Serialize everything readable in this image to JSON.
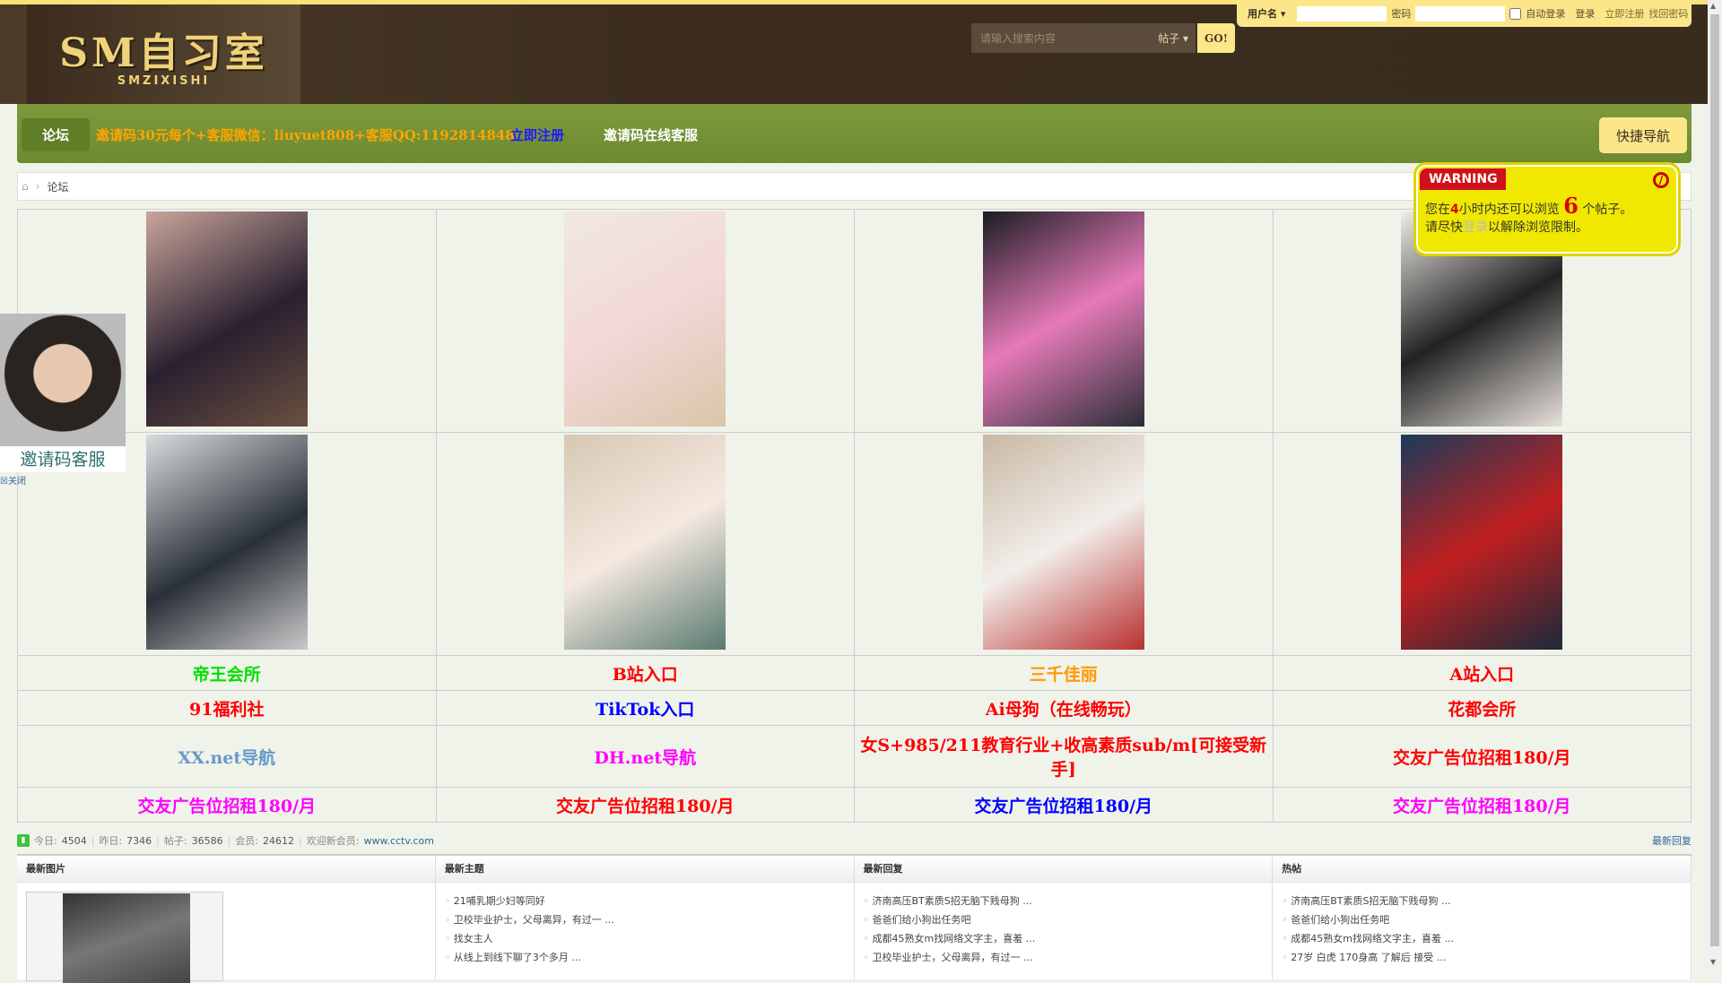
{
  "header": {
    "logo_text": "SM自习室",
    "logo_sub": "SMZIXISHI",
    "search_placeholder": "请输入搜索内容",
    "search_scope": "帖子",
    "go_label": "GO!"
  },
  "login": {
    "username_label": "用户名",
    "password_label": "密码",
    "auto_login": "自动登录",
    "login": "登录",
    "register": "立即注册",
    "forgot": "找回密码"
  },
  "nav": {
    "home": "论坛",
    "promo": "邀请码30元每个+客服微信：liuyuet808+客服QQ:1192814848",
    "register": "立即注册",
    "service": "邀请码在线客服",
    "quick": "快捷导航"
  },
  "breadcrumb": {
    "current": "论坛"
  },
  "links": [
    [
      {
        "t": "帝王会所",
        "c": "#00e000"
      },
      {
        "t": "B站入口",
        "c": "#ff0000"
      },
      {
        "t": "三千佳丽",
        "c": "#ff9900"
      },
      {
        "t": "A站入口",
        "c": "#ff0000"
      }
    ],
    [
      {
        "t": "91福利社",
        "c": "#ff0000"
      },
      {
        "t": "TikTok入口",
        "c": "#0000ff"
      },
      {
        "t": "Ai母狗（在线畅玩）",
        "c": "#ff0000"
      },
      {
        "t": "花都会所",
        "c": "#ff0000"
      }
    ],
    [
      {
        "t": "XX.net导航",
        "c": "#6699cc"
      },
      {
        "t": "DH.net导航",
        "c": "#ff00ff"
      },
      {
        "t": "女S+985/211教育行业+收高素质sub/m[可接受新手]",
        "c": "#ff0000"
      },
      {
        "t": "交友广告位招租180/月",
        "c": "#ff0000"
      }
    ],
    [
      {
        "t": "交友广告位招租180/月",
        "c": "#ff00ff"
      },
      {
        "t": "交友广告位招租180/月",
        "c": "#ff0000"
      },
      {
        "t": "交友广告位招租180/月",
        "c": "#0000ff"
      },
      {
        "t": "交友广告位招租180/月",
        "c": "#ff00ff"
      }
    ]
  ],
  "stats": {
    "today_label": "今日:",
    "today": "4504",
    "yesterday_label": "昨日:",
    "yesterday": "7346",
    "posts_label": "帖子:",
    "posts": "36586",
    "members_label": "会员:",
    "members": "24612",
    "welcome_label": "欢迎新会员:",
    "newest": "www.cctv.com",
    "latest_reply_link": "最新回复"
  },
  "panels": {
    "pics": "最新图片",
    "topics": "最新主题",
    "replies": "最新回复",
    "hot": "热帖",
    "topic_items": [
      "21哺乳期少妇等同好",
      "卫校毕业护士，父母离异，有过一 ...",
      "找女主人",
      "从线上到线下聊了3个多月 ..."
    ],
    "reply_items": [
      "济南高压BT素质S招无脑下贱母狗 ...",
      "爸爸们给小狗出任务吧",
      "成都45熟女m找网络文字主，喜羞 ...",
      "卫校毕业护士，父母离异，有过一 ..."
    ],
    "hot_items": [
      "济南高压BT素质S招无脑下贱母狗 ...",
      "爸爸们给小狗出任务吧",
      "成都45熟女m找网络文字主，喜羞 ...",
      "27岁 白虎 170身高 了解后 接受 ..."
    ]
  },
  "ad": {
    "label": "邀请码客服",
    "close": "关闭"
  },
  "warning": {
    "tag": "WARNING",
    "pre": "您在",
    "hours": "4",
    "mid": "小时内还可以浏览",
    "count": "6",
    "post": "个帖子。",
    "line2a": "请尽快",
    "login": "登录",
    "line2b": "以解除浏览限制。"
  }
}
